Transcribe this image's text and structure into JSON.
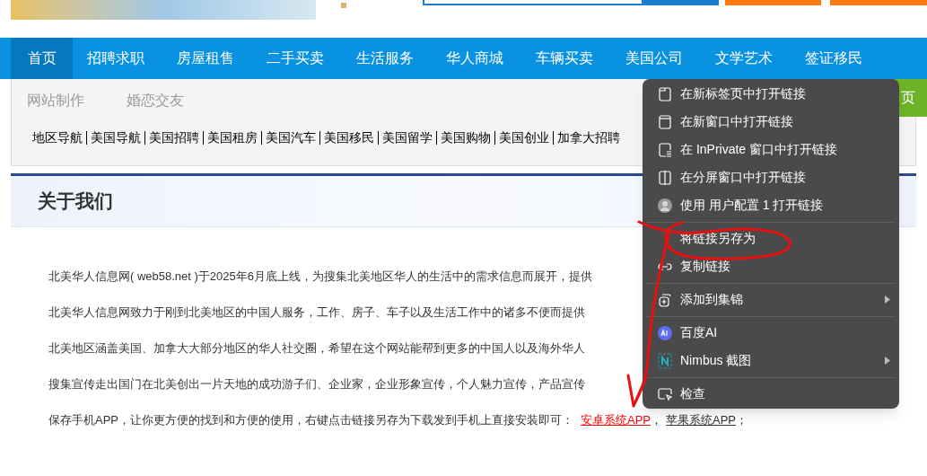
{
  "nav": {
    "items": [
      {
        "label": "首页",
        "selected": true
      },
      {
        "label": "招聘求职",
        "selected": false
      },
      {
        "label": "房屋租售",
        "selected": false
      },
      {
        "label": "二手买卖",
        "selected": false
      },
      {
        "label": "生活服务",
        "selected": false
      },
      {
        "label": "华人商城",
        "selected": false
      },
      {
        "label": "车辆买卖",
        "selected": false
      },
      {
        "label": "美国公司",
        "selected": false
      },
      {
        "label": "文学艺术",
        "selected": false
      },
      {
        "label": "签证移民",
        "selected": false
      }
    ]
  },
  "subnav": {
    "items": [
      "网站制作",
      "婚恋交友"
    ],
    "green_button": "页"
  },
  "quick_links": [
    "地区导航",
    "美国导航",
    "美国招聘",
    "美国租房",
    "美国汽车",
    "美国移民",
    "美国留学",
    "美国购物",
    "美国创业",
    "加拿大招聘"
  ],
  "section": {
    "title": "关于我们"
  },
  "paragraphs": [
    "北美华人信息网( web58.net )于2025年6月底上线，为搜集北美地区华人的生活中的需求信息而展开，提供",
    "北美华人信息网致力于刚到北美地区的中国人服务，工作、房子、车子以及生活工作中的诸多不便而提供",
    "北美地区涵盖美国、加拿大大部分地区的华人社交圈，希望在这个网站能帮到更多的中国人以及海外华人",
    "搜集宣传走出国门在北美创出一片天地的成功游子们、企业家，企业形象宣传，个人魅力宣传，产品宣传"
  ],
  "download_line": {
    "text": "保存手机APP，让你更方便的找到和方便的使用，右键点击链接另存为下载发到手机上直接安装即可：",
    "links": [
      {
        "label": "安卓系统APP",
        "kind": "android"
      },
      {
        "label": "苹果系统APP",
        "kind": "apple"
      }
    ],
    "separator": "，",
    "end": "；"
  },
  "context_menu": {
    "groups": [
      [
        {
          "label": "在新标签页中打开链接",
          "submenu": false
        },
        {
          "label": "在新窗口中打开链接",
          "submenu": false
        },
        {
          "label": "在 InPrivate 窗口中打开链接",
          "submenu": false
        },
        {
          "label": "在分屏窗口中打开链接",
          "submenu": false
        },
        {
          "label": "使用 用户配置 1 打开链接",
          "submenu": false
        }
      ],
      [
        {
          "label": "将链接另存为",
          "submenu": false
        },
        {
          "label": "复制链接",
          "submenu": false
        }
      ],
      [
        {
          "label": "添加到集锦",
          "submenu": true
        }
      ],
      [
        {
          "label": "百度AI",
          "submenu": false
        },
        {
          "label": "Nimbus 截图",
          "submenu": true
        }
      ],
      [
        {
          "label": "检查",
          "submenu": false
        }
      ]
    ]
  }
}
